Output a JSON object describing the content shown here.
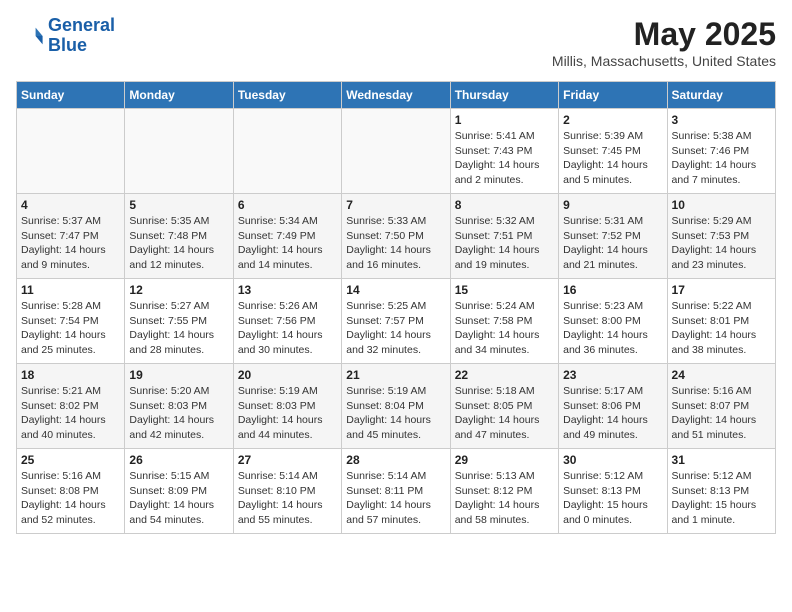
{
  "header": {
    "logo_line1": "General",
    "logo_line2": "Blue",
    "title": "May 2025",
    "subtitle": "Millis, Massachusetts, United States"
  },
  "days_of_week": [
    "Sunday",
    "Monday",
    "Tuesday",
    "Wednesday",
    "Thursday",
    "Friday",
    "Saturday"
  ],
  "weeks": [
    [
      {
        "num": "",
        "info": ""
      },
      {
        "num": "",
        "info": ""
      },
      {
        "num": "",
        "info": ""
      },
      {
        "num": "",
        "info": ""
      },
      {
        "num": "1",
        "info": "Sunrise: 5:41 AM\nSunset: 7:43 PM\nDaylight: 14 hours\nand 2 minutes."
      },
      {
        "num": "2",
        "info": "Sunrise: 5:39 AM\nSunset: 7:45 PM\nDaylight: 14 hours\nand 5 minutes."
      },
      {
        "num": "3",
        "info": "Sunrise: 5:38 AM\nSunset: 7:46 PM\nDaylight: 14 hours\nand 7 minutes."
      }
    ],
    [
      {
        "num": "4",
        "info": "Sunrise: 5:37 AM\nSunset: 7:47 PM\nDaylight: 14 hours\nand 9 minutes."
      },
      {
        "num": "5",
        "info": "Sunrise: 5:35 AM\nSunset: 7:48 PM\nDaylight: 14 hours\nand 12 minutes."
      },
      {
        "num": "6",
        "info": "Sunrise: 5:34 AM\nSunset: 7:49 PM\nDaylight: 14 hours\nand 14 minutes."
      },
      {
        "num": "7",
        "info": "Sunrise: 5:33 AM\nSunset: 7:50 PM\nDaylight: 14 hours\nand 16 minutes."
      },
      {
        "num": "8",
        "info": "Sunrise: 5:32 AM\nSunset: 7:51 PM\nDaylight: 14 hours\nand 19 minutes."
      },
      {
        "num": "9",
        "info": "Sunrise: 5:31 AM\nSunset: 7:52 PM\nDaylight: 14 hours\nand 21 minutes."
      },
      {
        "num": "10",
        "info": "Sunrise: 5:29 AM\nSunset: 7:53 PM\nDaylight: 14 hours\nand 23 minutes."
      }
    ],
    [
      {
        "num": "11",
        "info": "Sunrise: 5:28 AM\nSunset: 7:54 PM\nDaylight: 14 hours\nand 25 minutes."
      },
      {
        "num": "12",
        "info": "Sunrise: 5:27 AM\nSunset: 7:55 PM\nDaylight: 14 hours\nand 28 minutes."
      },
      {
        "num": "13",
        "info": "Sunrise: 5:26 AM\nSunset: 7:56 PM\nDaylight: 14 hours\nand 30 minutes."
      },
      {
        "num": "14",
        "info": "Sunrise: 5:25 AM\nSunset: 7:57 PM\nDaylight: 14 hours\nand 32 minutes."
      },
      {
        "num": "15",
        "info": "Sunrise: 5:24 AM\nSunset: 7:58 PM\nDaylight: 14 hours\nand 34 minutes."
      },
      {
        "num": "16",
        "info": "Sunrise: 5:23 AM\nSunset: 8:00 PM\nDaylight: 14 hours\nand 36 minutes."
      },
      {
        "num": "17",
        "info": "Sunrise: 5:22 AM\nSunset: 8:01 PM\nDaylight: 14 hours\nand 38 minutes."
      }
    ],
    [
      {
        "num": "18",
        "info": "Sunrise: 5:21 AM\nSunset: 8:02 PM\nDaylight: 14 hours\nand 40 minutes."
      },
      {
        "num": "19",
        "info": "Sunrise: 5:20 AM\nSunset: 8:03 PM\nDaylight: 14 hours\nand 42 minutes."
      },
      {
        "num": "20",
        "info": "Sunrise: 5:19 AM\nSunset: 8:03 PM\nDaylight: 14 hours\nand 44 minutes."
      },
      {
        "num": "21",
        "info": "Sunrise: 5:19 AM\nSunset: 8:04 PM\nDaylight: 14 hours\nand 45 minutes."
      },
      {
        "num": "22",
        "info": "Sunrise: 5:18 AM\nSunset: 8:05 PM\nDaylight: 14 hours\nand 47 minutes."
      },
      {
        "num": "23",
        "info": "Sunrise: 5:17 AM\nSunset: 8:06 PM\nDaylight: 14 hours\nand 49 minutes."
      },
      {
        "num": "24",
        "info": "Sunrise: 5:16 AM\nSunset: 8:07 PM\nDaylight: 14 hours\nand 51 minutes."
      }
    ],
    [
      {
        "num": "25",
        "info": "Sunrise: 5:16 AM\nSunset: 8:08 PM\nDaylight: 14 hours\nand 52 minutes."
      },
      {
        "num": "26",
        "info": "Sunrise: 5:15 AM\nSunset: 8:09 PM\nDaylight: 14 hours\nand 54 minutes."
      },
      {
        "num": "27",
        "info": "Sunrise: 5:14 AM\nSunset: 8:10 PM\nDaylight: 14 hours\nand 55 minutes."
      },
      {
        "num": "28",
        "info": "Sunrise: 5:14 AM\nSunset: 8:11 PM\nDaylight: 14 hours\nand 57 minutes."
      },
      {
        "num": "29",
        "info": "Sunrise: 5:13 AM\nSunset: 8:12 PM\nDaylight: 14 hours\nand 58 minutes."
      },
      {
        "num": "30",
        "info": "Sunrise: 5:12 AM\nSunset: 8:13 PM\nDaylight: 15 hours\nand 0 minutes."
      },
      {
        "num": "31",
        "info": "Sunrise: 5:12 AM\nSunset: 8:13 PM\nDaylight: 15 hours\nand 1 minute."
      }
    ]
  ]
}
